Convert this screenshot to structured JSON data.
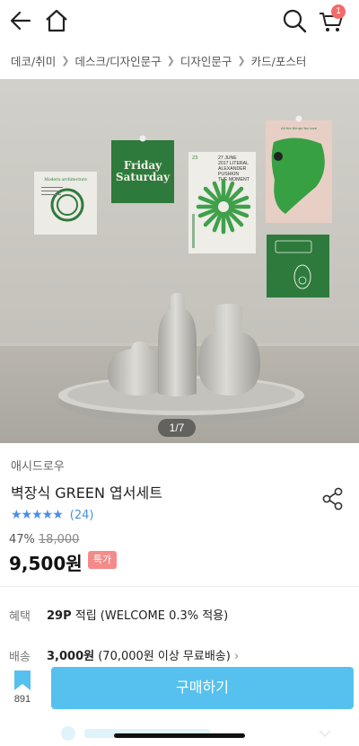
{
  "header": {
    "cart_count": "1"
  },
  "breadcrumb": [
    "데코/취미",
    "데스크/디자인문구",
    "디자인문구",
    "카드/포스터"
  ],
  "gallery": {
    "counter": "1/7",
    "cards": {
      "architecture_title": "Modern architecture",
      "friday_line1": "Friday",
      "friday_line2": "Saturday",
      "pushkin_lines": [
        "27 JUNE",
        "2017 LITERAL",
        "ALEXANDER",
        "PUSHKIN",
        "THE MOMENT"
      ],
      "pushkin_number": "23",
      "things_title": "All the things You love"
    }
  },
  "product": {
    "brand": "애시드로우",
    "title": "벽장식 GREEN 엽서세트",
    "stars": "★★★★★",
    "review_count": "(24)",
    "discount": "47%",
    "original_price": "18,000",
    "price": "9,500원",
    "special_badge": "특가"
  },
  "benefit": {
    "label": "혜택",
    "points": "29P",
    "text": " 적립 (WELCOME 0.3% 적용)"
  },
  "shipping": {
    "label": "배송",
    "fee": "3,000원",
    "text": " (70,000원 이상 무료배송)",
    "chevron": "›"
  },
  "bottom_bar": {
    "bookmark_count": "891",
    "buy_label": "구매하기"
  },
  "colors": {
    "accent_blue": "#56c1ee",
    "star_blue": "#4a90e2",
    "badge_red": "#f26a6a",
    "card_green": "#2e7a3c"
  },
  "icons": [
    "back-arrow-icon",
    "home-icon",
    "search-icon",
    "cart-icon",
    "share-icon",
    "bookmark-icon"
  ]
}
